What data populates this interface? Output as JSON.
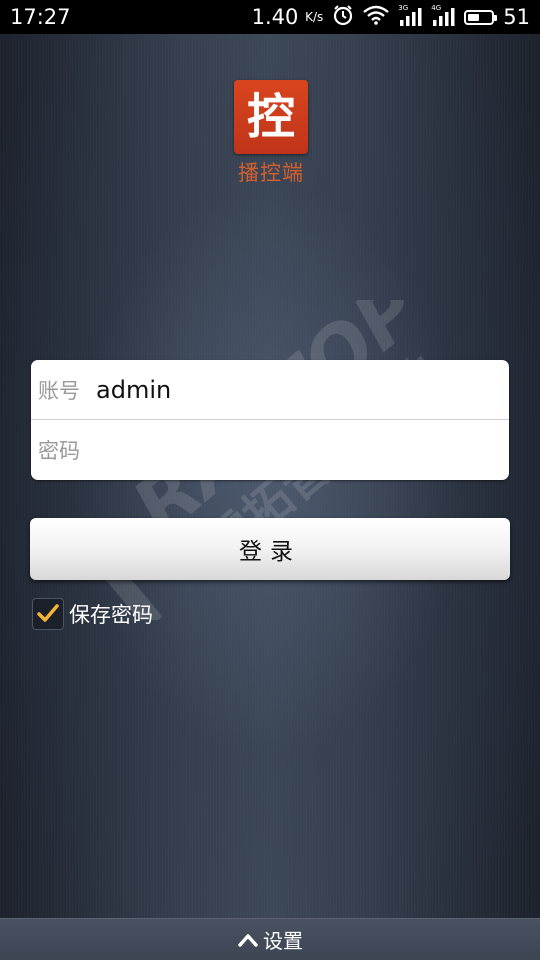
{
  "status_bar": {
    "time": "17:27",
    "speed_value": "1.40",
    "speed_unit": "K/s",
    "signal1_tag": "3G",
    "signal2_tag": "4G",
    "battery_level": "51",
    "battery_fraction": 0.51
  },
  "app": {
    "logo_glyph": "控",
    "logo_color": "#c9391b",
    "title": "播控端"
  },
  "watermark": {
    "brand": "RATTOP",
    "subtitle": "雷拓音频科技"
  },
  "login": {
    "account_label": "账号",
    "account_value": "admin",
    "password_label": "密码",
    "password_value": "",
    "button_label": "登录"
  },
  "save_password": {
    "label": "保存密码",
    "checked": true,
    "check_color": "#f5b530"
  },
  "bottom_bar": {
    "label": "设置"
  }
}
